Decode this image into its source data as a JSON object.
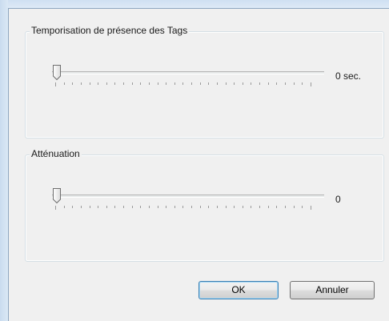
{
  "dialog": {
    "presence_group": {
      "title": "Temporisation de présence des Tags",
      "slider_value": 0,
      "value_label": "0 sec."
    },
    "attenuation_group": {
      "title": "Atténuation",
      "slider_value": 0,
      "value_label": "0"
    },
    "buttons": {
      "ok_label": "OK",
      "cancel_label": "Annuler"
    }
  },
  "colors": {
    "dialog_background": "#f0f0f0",
    "window_frame": "#dbe8f5",
    "ok_button_border": "#3c7fb1"
  }
}
